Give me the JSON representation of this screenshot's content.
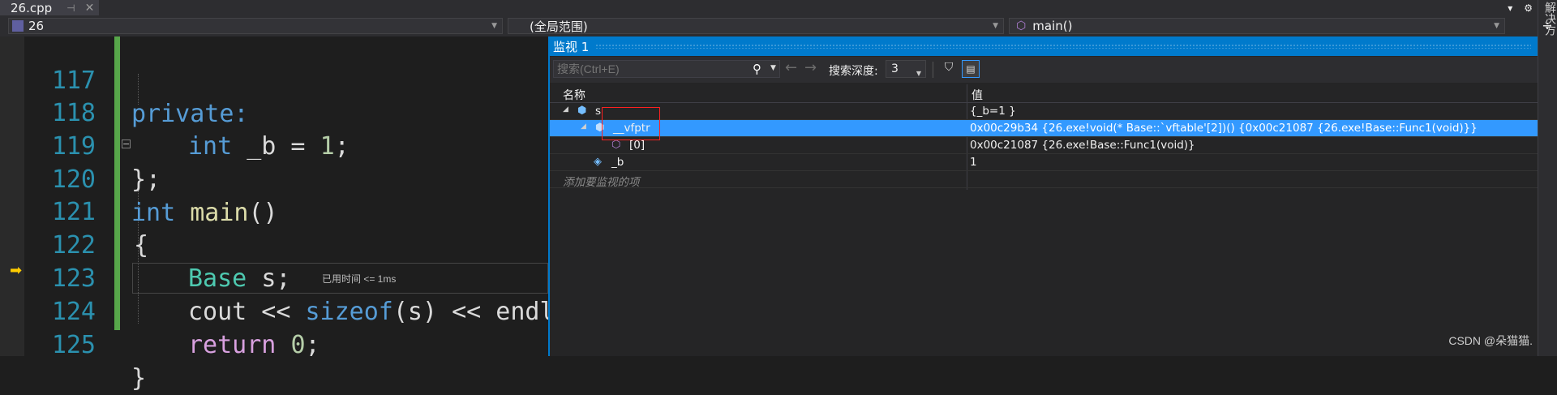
{
  "tab": {
    "title": "26.cpp",
    "pin": "⊣",
    "close": "✕"
  },
  "topright": {
    "dropdown": "▾",
    "gear": "⚙"
  },
  "sidestrip": {
    "vertical_text": "解决方",
    "button": "÷"
  },
  "navbar": {
    "project": "26",
    "scope": "(全局范围)",
    "function": "main()"
  },
  "code": {
    "lines": [
      {
        "num": "117",
        "text": "private:"
      },
      {
        "num": "118",
        "text": "int _b = 1;"
      },
      {
        "num": "119",
        "text": "};"
      },
      {
        "num": "120",
        "text": "int main()"
      },
      {
        "num": "121",
        "text": "{"
      },
      {
        "num": "122",
        "text": "Base s;"
      },
      {
        "num": "123",
        "text": "cout << sizeof(s) << endl;"
      },
      {
        "num": "124",
        "text": "return 0;"
      },
      {
        "num": "125",
        "text": "}"
      }
    ],
    "elapsed": "已用时间 <= 1ms",
    "collapse": "−"
  },
  "watch": {
    "title": "监视 1",
    "search_placeholder": "搜索(Ctrl+E)",
    "depth_label": "搜索深度:",
    "depth_value": "3",
    "col_name": "名称",
    "col_value": "值",
    "rows": [
      {
        "name": "s",
        "value": "{_b=1 }"
      },
      {
        "name": "__vfptr",
        "value": "0x00c29b34 {26.exe!void(* Base::`vftable'[2])() {0x00c21087 {26.exe!Base::Func1(void)}}"
      },
      {
        "name": "[0]",
        "value": "0x00c21087 {26.exe!Base::Func1(void)}"
      },
      {
        "name": "_b",
        "value": "1"
      }
    ],
    "add_item": "添加要监视的项"
  },
  "watermark": "CSDN @朵猫猫."
}
